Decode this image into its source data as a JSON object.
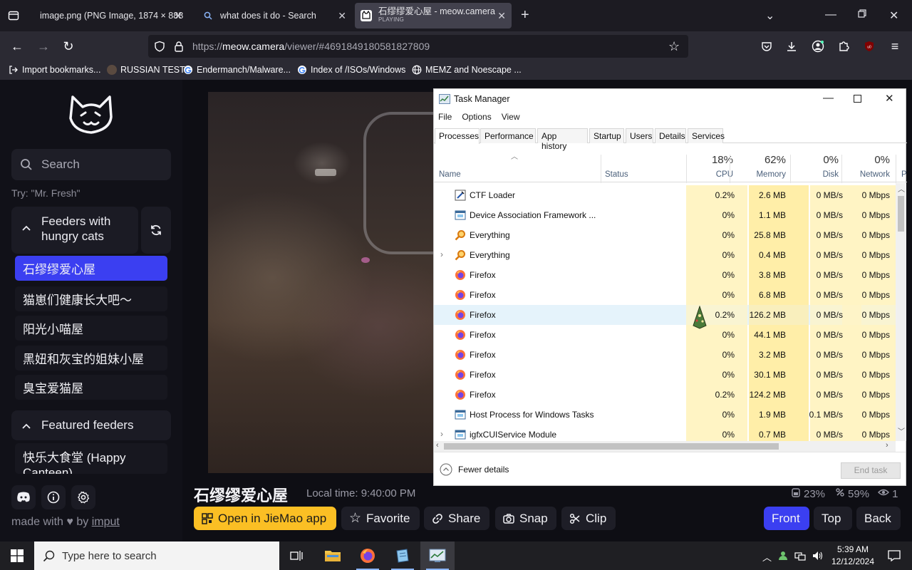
{
  "browser": {
    "tabs": [
      {
        "title": "image.png (PNG Image, 1874 × 888",
        "active": false
      },
      {
        "title": "what does it do - Search",
        "active": false
      },
      {
        "title": "石缪缪爱心屋 - meow.camera",
        "status": "PLAYING",
        "active": true
      }
    ],
    "url_prefix": "https://",
    "url_host": "meow.camera",
    "url_path": "/viewer/#4691849180581827809",
    "bookmarks": [
      "Import bookmarks...",
      "RUSSIAN TEST",
      "Endermanch/Malware...",
      "Index of /ISOs/Windows",
      "MEMZ and Noescape ..."
    ]
  },
  "sidebar": {
    "search_placeholder": "Search",
    "try_hint": "Try: \"Mr. Fresh\"",
    "group1_title": "Feeders with hungry cats",
    "group1_items": [
      "石缪缪爱心屋",
      "猫崽们健康长大吧～",
      "阳光小喵屋",
      "黑妞和灰宝的姐妹小屋",
      "臭宝爱猫屋"
    ],
    "group2_title": "Featured feeders",
    "group2_items": [
      "快乐大食堂 (Happy Canteen)"
    ],
    "made_with": "made with",
    "by": "by",
    "author": "imput"
  },
  "viewer": {
    "title": "石缪缪爱心屋",
    "local_time": "Local time: 9:40:00 PM",
    "stat_food": "23%",
    "stat_battery": "59%",
    "stat_viewers": "1",
    "buttons": {
      "open_app": "Open in JieMao app",
      "favorite": "Favorite",
      "share": "Share",
      "snap": "Snap",
      "clip": "Clip",
      "front": "Front",
      "top": "Top",
      "back": "Back"
    }
  },
  "task_manager": {
    "title": "Task Manager",
    "menu": [
      "File",
      "Options",
      "View"
    ],
    "tabs": [
      "Processes",
      "Performance",
      "App history",
      "Startup",
      "Users",
      "Details",
      "Services"
    ],
    "columns": {
      "name": "Name",
      "status": "Status",
      "cpu_pct": "18%",
      "cpu": "CPU",
      "mem_pct": "62%",
      "mem": "Memory",
      "disk_pct": "0%",
      "disk": "Disk",
      "net_pct": "0%",
      "net": "Network",
      "extra": "P"
    },
    "rows": [
      {
        "name": "CTF Loader",
        "cpu": "0.2%",
        "mem": "2.6 MB",
        "disk": "0 MB/s",
        "net": "0 Mbps",
        "icon": "ctf-icon"
      },
      {
        "name": "Device Association Framework ...",
        "cpu": "0%",
        "mem": "1.1 MB",
        "disk": "0 MB/s",
        "net": "0 Mbps",
        "icon": "service-icon"
      },
      {
        "name": "Everything",
        "cpu": "0%",
        "mem": "25.8 MB",
        "disk": "0 MB/s",
        "net": "0 Mbps",
        "icon": "everything-icon"
      },
      {
        "name": "Everything",
        "cpu": "0%",
        "mem": "0.4 MB",
        "disk": "0 MB/s",
        "net": "0 Mbps",
        "icon": "everything-icon"
      },
      {
        "name": "Firefox",
        "cpu": "0%",
        "mem": "3.8 MB",
        "disk": "0 MB/s",
        "net": "0 Mbps",
        "icon": "firefox-icon"
      },
      {
        "name": "Firefox",
        "cpu": "0%",
        "mem": "6.8 MB",
        "disk": "0 MB/s",
        "net": "0 Mbps",
        "icon": "firefox-icon"
      },
      {
        "name": "Firefox",
        "cpu": "0.2%",
        "mem": "126.2 MB",
        "disk": "0 MB/s",
        "net": "0 Mbps",
        "icon": "firefox-icon"
      },
      {
        "name": "Firefox",
        "cpu": "0%",
        "mem": "44.1 MB",
        "disk": "0 MB/s",
        "net": "0 Mbps",
        "icon": "firefox-icon"
      },
      {
        "name": "Firefox",
        "cpu": "0%",
        "mem": "3.2 MB",
        "disk": "0 MB/s",
        "net": "0 Mbps",
        "icon": "firefox-icon"
      },
      {
        "name": "Firefox",
        "cpu": "0%",
        "mem": "30.1 MB",
        "disk": "0 MB/s",
        "net": "0 Mbps",
        "icon": "firefox-icon"
      },
      {
        "name": "Firefox",
        "cpu": "0.2%",
        "mem": "124.2 MB",
        "disk": "0 MB/s",
        "net": "0 Mbps",
        "icon": "firefox-icon"
      },
      {
        "name": "Host Process for Windows Tasks",
        "cpu": "0%",
        "mem": "1.9 MB",
        "disk": "0.1 MB/s",
        "net": "0 Mbps",
        "icon": "service-icon"
      },
      {
        "name": "igfxCUIService Module",
        "cpu": "0%",
        "mem": "0.7 MB",
        "disk": "0 MB/s",
        "net": "0 Mbps",
        "icon": "service-icon"
      }
    ],
    "fewer_details": "Fewer details",
    "end_task": "End task"
  },
  "taskbar": {
    "search_placeholder": "Type here to search",
    "time": "5:39 AM",
    "date": "12/12/2024"
  },
  "colors": {
    "accent": "#3b3ff1",
    "open_app": "#fbbf24",
    "tm_highlight": "#fff4c4"
  }
}
